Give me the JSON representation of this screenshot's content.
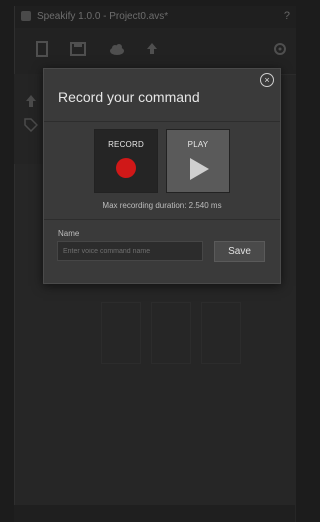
{
  "app": {
    "title": "Speakify 1.0.0 - Project0.avs*",
    "help": "?"
  },
  "toolbar": {
    "icons": [
      "file-icon",
      "save-icon",
      "cloud-icon",
      "upload-icon",
      "gear-icon"
    ]
  },
  "dialog": {
    "title": "Record your command",
    "close": "×",
    "record_label": "RECORD",
    "play_label": "PLAY",
    "max_duration": "Max recording duration: 2.540 ms",
    "name_label": "Name",
    "name_placeholder": "Enter voice command name",
    "name_value": "",
    "save_label": "Save",
    "record_color": "#d01818"
  },
  "statusbar": {
    "left": "",
    "right": ""
  }
}
